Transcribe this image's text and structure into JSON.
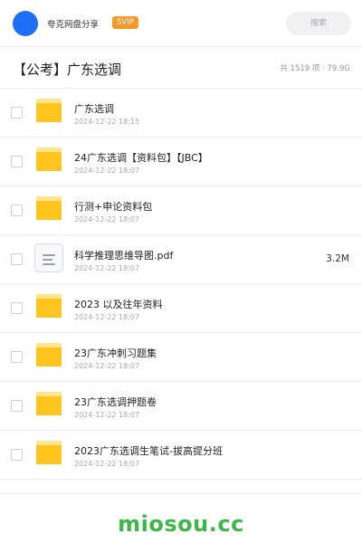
{
  "header": {
    "username": "夸克网盘分享",
    "badge": "SVIP",
    "search_placeholder": "搜索"
  },
  "folder": {
    "title": "【公考】广东选调",
    "summary": "共 1519 项 · 79.9G"
  },
  "files": [
    {
      "name": "广东选调",
      "date": "2024-12-22 18:15",
      "type": "folder",
      "size": ""
    },
    {
      "name": "24广东选调【资料包】【JBC】",
      "date": "2024-12-22 18:07",
      "type": "folder",
      "size": ""
    },
    {
      "name": "行测+申论资料包",
      "date": "2024-12-22 18:07",
      "type": "folder",
      "size": ""
    },
    {
      "name": "科学推理思维导图.pdf",
      "date": "2024-12-22 18:07",
      "type": "document",
      "size": "3.2M"
    },
    {
      "name": "2023 以及往年资料",
      "date": "2024-12-22 18:07",
      "type": "folder",
      "size": ""
    },
    {
      "name": "23广东冲刺习题集",
      "date": "2024-12-22 18:07",
      "type": "folder",
      "size": ""
    },
    {
      "name": "23广东选调押题卷",
      "date": "2024-12-22 18:07",
      "type": "folder",
      "size": ""
    },
    {
      "name": "2023广东选调生笔试-拔高提分班",
      "date": "2024-12-22 18:07",
      "type": "folder",
      "size": ""
    }
  ],
  "watermark": "miosou.cc",
  "colors": {
    "avatar": "#1e6ff5",
    "badge": "#f39a2b",
    "folder_icon": "#ffc51e",
    "watermark": "#3db64a"
  }
}
